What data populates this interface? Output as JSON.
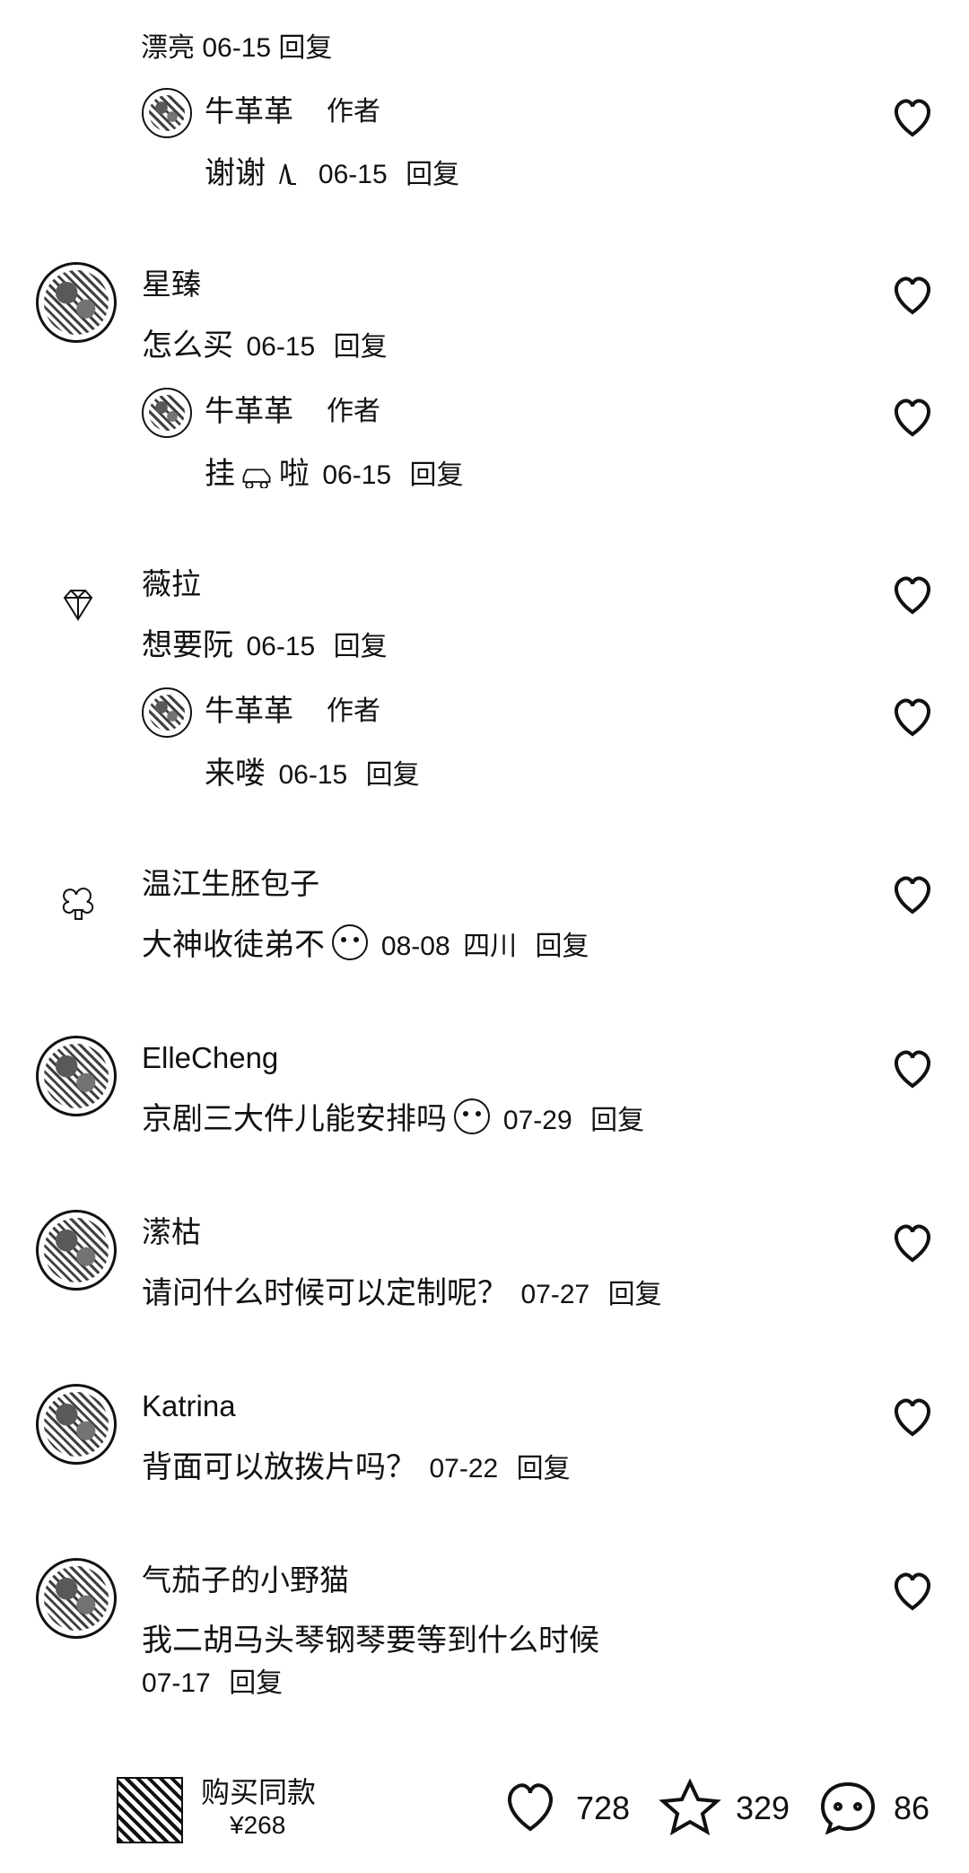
{
  "top_partial": {
    "text": "漂亮 06-15 回复"
  },
  "comments": [
    {
      "user": "牛革革",
      "author_tag": "作者",
      "text": "谢谢",
      "date": "06-15",
      "reply": "回复"
    },
    {
      "user": "星臻",
      "text": "怎么买",
      "date": "06-15",
      "reply": "回复"
    },
    {
      "user": "牛革革",
      "author_tag": "作者",
      "text_before": "挂",
      "text_after": "啦",
      "date": "06-15",
      "reply": "回复"
    },
    {
      "user": "薇拉",
      "text": "想要阮",
      "date": "06-15",
      "reply": "回复"
    },
    {
      "user": "牛革革",
      "author_tag": "作者",
      "text": "来喽",
      "date": "06-15",
      "reply": "回复"
    },
    {
      "user": "温江生胚包子",
      "text": "大神收徒弟不",
      "date": "08-08",
      "location": "四川",
      "reply": "回复"
    },
    {
      "user": "ElleCheng",
      "text": "京剧三大件儿能安排吗",
      "date": "07-29",
      "reply": "回复"
    },
    {
      "user": "潆枯",
      "text": "请问什么时候可以定制呢？",
      "date": "07-27",
      "reply": "回复"
    },
    {
      "user": "Katrina",
      "text": "背面可以放拨片吗？",
      "date": "07-22",
      "reply": "回复"
    },
    {
      "user": "气茄子的小野猫",
      "text": "我二胡马头琴钢琴要等到什么时候",
      "date": "07-17",
      "reply": "回复"
    }
  ],
  "bottom_bar": {
    "product_title": "购买同款",
    "price": "¥268",
    "likes": "728",
    "favorites": "329",
    "comments": "86"
  },
  "icons": {
    "like": "heart-outline-icon",
    "favorite": "star-outline-icon",
    "comment": "chat-bubble-icon"
  }
}
